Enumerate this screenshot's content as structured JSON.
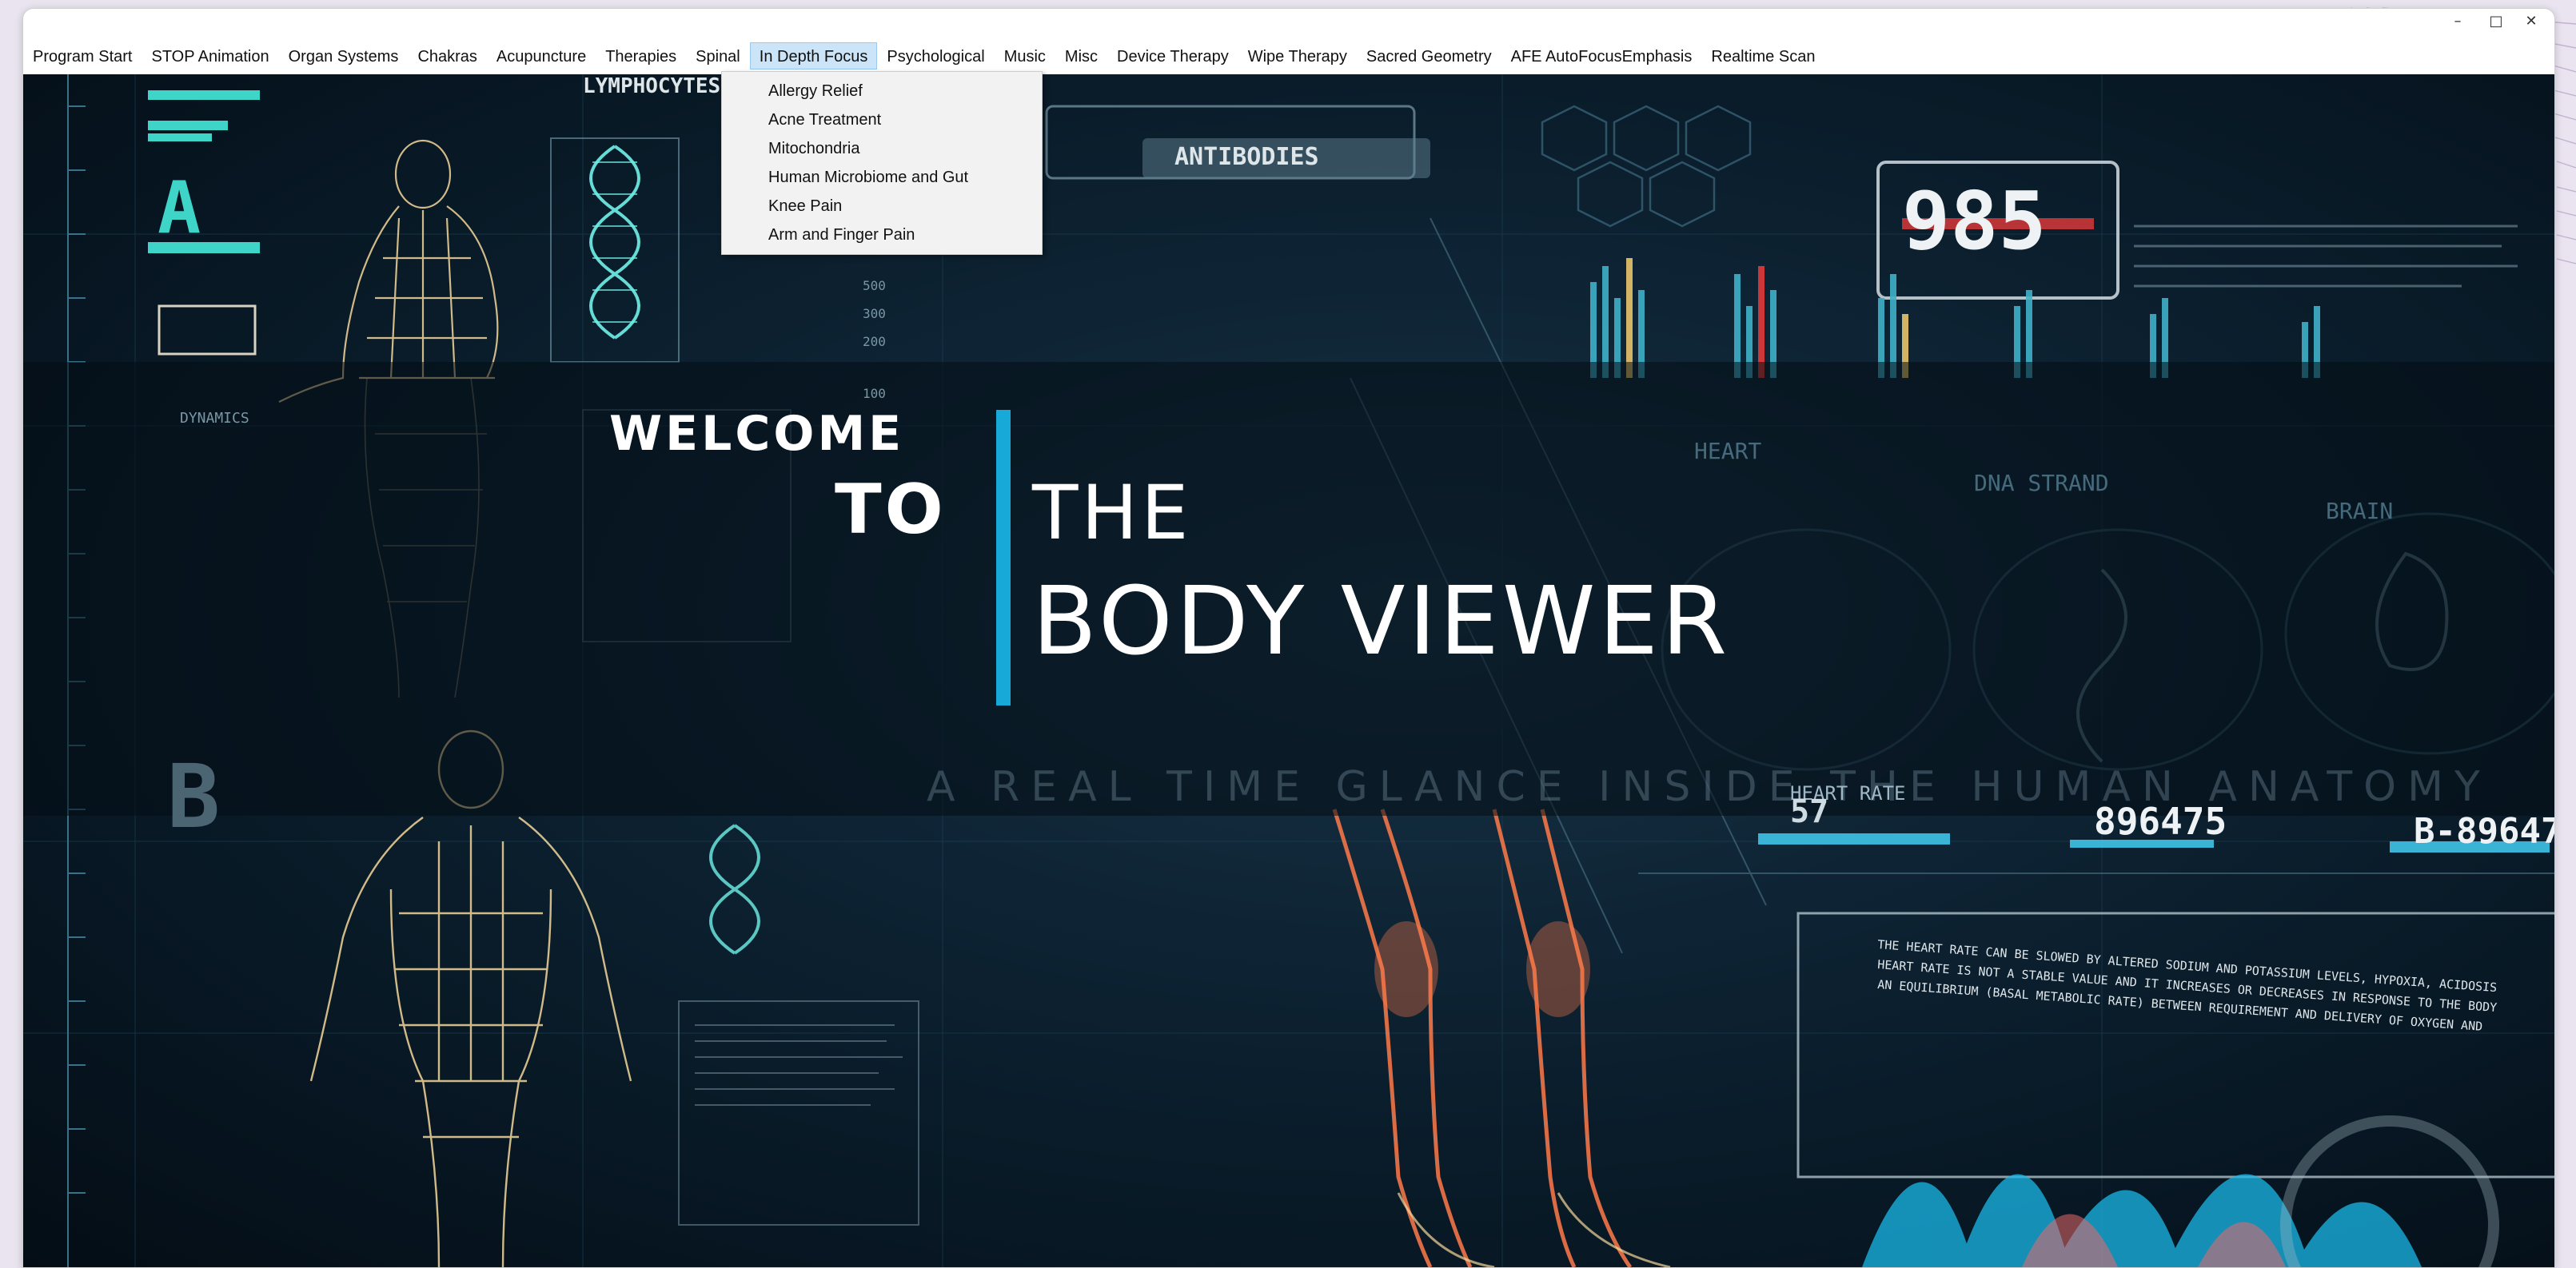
{
  "window": {
    "title": ""
  },
  "menu": {
    "items": [
      "Program Start",
      "STOP Animation",
      "Organ Systems",
      "Chakras",
      "Acupuncture",
      "Therapies",
      "Spinal",
      "In Depth Focus",
      "Psychological",
      "Music",
      "Misc",
      "Device Therapy",
      "Wipe Therapy",
      "Sacred Geometry",
      "AFE AutoFocusEmphasis",
      "Realtime Scan"
    ],
    "active": "In Depth Focus"
  },
  "dropdown": {
    "items": [
      "Allergy Relief",
      "Acne Treatment",
      "Mitochondria",
      "Human Microbiome and Gut",
      "Knee Pain",
      "Arm and Finger Pain"
    ]
  },
  "splash": {
    "line1": "WELCOME",
    "line2": "TO",
    "line3": "THE",
    "line4": "BODY VIEWER",
    "tagline": "A REAL TIME GLANCE INSIDE THE HUMAN ANATOMY"
  },
  "hud": {
    "counter": "985",
    "antibodies": "ANTIBODIES",
    "lymphocytes": "LYMPHOCYTES",
    "letter_a": "A",
    "letter_b": "B",
    "heart_rate": "HEART RATE",
    "heart_value": "57",
    "code1": "896475",
    "code2": "B-89647",
    "heart": "HEART",
    "dna_strand": "DNA STRAND",
    "brain": "BRAIN",
    "dynamics": "DYNAMICS",
    "ticks": [
      "500",
      "300",
      "200",
      "100"
    ],
    "heart_note": "THE HEART RATE CAN BE SLOWED BY ALTERED SODIUM AND POTASSIUM LEVELS, HYPOXIA, ACIDOSIS",
    "heart_note2": "HEART RATE IS NOT A STABLE VALUE AND IT INCREASES OR DECREASES IN RESPONSE TO THE BODY",
    "heart_note3": "AN EQUILIBRIUM (BASAL METABOLIC RATE) BETWEEN REQUIREMENT AND DELIVERY OF OXYGEN AND"
  },
  "colors": {
    "accent_bar": "#17a9d8",
    "menu_active": "#cce4f7",
    "wireframe": "#f3d79a",
    "dna": "#6ff1e8",
    "legs": "#ff7a4a",
    "wave": "#1ab8e8"
  },
  "icons": [
    "minimize-icon",
    "maximize-icon",
    "close-icon"
  ]
}
